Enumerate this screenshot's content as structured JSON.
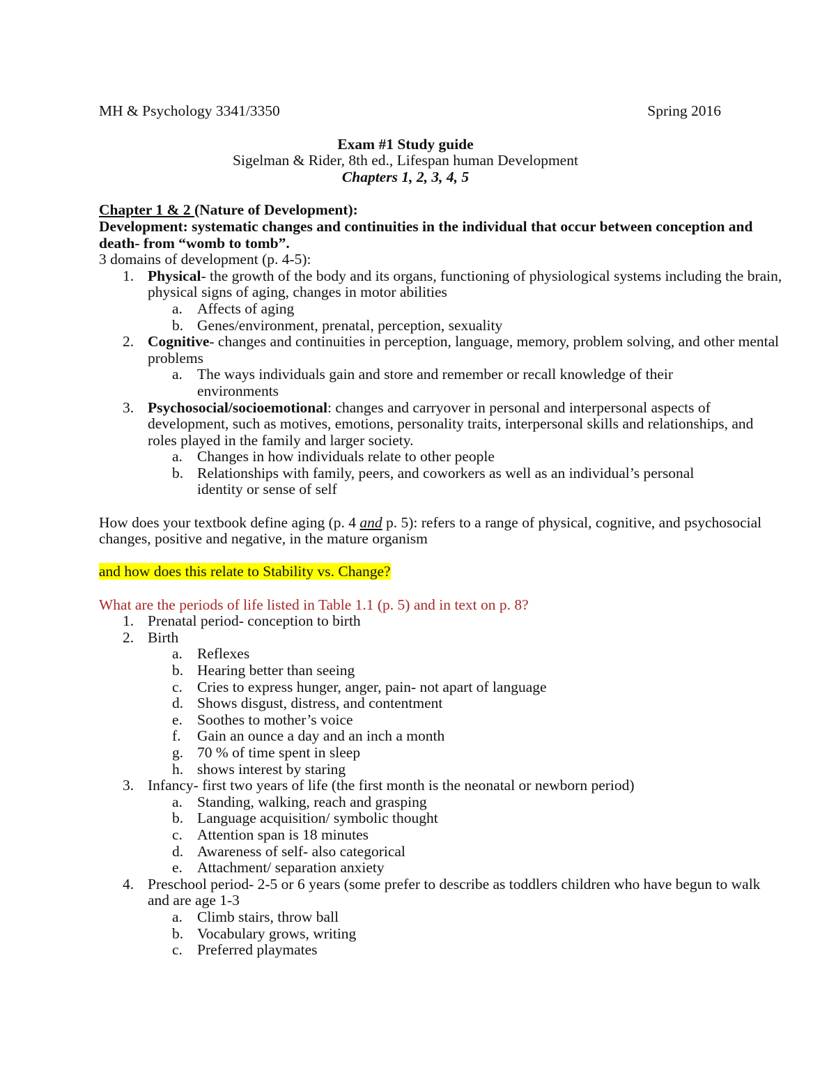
{
  "header": {
    "course": "MH & Psychology 3341/3350",
    "term": "Spring 2016",
    "title": "Exam #1 Study guide",
    "textbook": "Sigelman & Rider, 8th ed., Lifespan human Development",
    "chapters": "Chapters 1, 2, 3, 4, 5"
  },
  "section1": {
    "heading_underlined": "Chapter 1 & 2 ",
    "heading_rest": "(Nature of Development):",
    "definition": "Development: systematic changes and continuities in the individual that occur between conception and death- from “womb to tomb”.",
    "domains_intro": "3 domains of development (p. 4-5):",
    "domains": [
      {
        "num": "1.",
        "term": "Physical",
        "text": "- the growth of the body and its organs, functioning of physiological systems including the brain, physical signs of aging, changes in motor abilities",
        "sub": [
          {
            "letter": "a.",
            "text": "Affects of aging"
          },
          {
            "letter": "b.",
            "text": "Genes/environment, prenatal, perception, sexuality"
          }
        ]
      },
      {
        "num": "2.",
        "term": "Cognitive",
        "text": "- changes and continuities in perception, language, memory, problem solving, and other mental problems",
        "sub": [
          {
            "letter": "a.",
            "text": "The ways individuals gain and store and remember or recall knowledge of their environments"
          }
        ]
      },
      {
        "num": "3.",
        "term": "Psychosocial/socioemotional",
        "text": ": changes and carryover in personal and interpersonal aspects of development, such as motives, emotions, personality traits, interpersonal skills and relationships, and roles played in the family and larger society.",
        "sub": [
          {
            "letter": "a.",
            "text": "Changes in how individuals relate to other people"
          },
          {
            "letter": "b.",
            "text": "Relationships with family, peers, and coworkers as well as an individual’s personal identity or sense of self"
          }
        ]
      }
    ]
  },
  "aging": {
    "part1": "How does your textbook define aging (p. 4 ",
    "emphasis": "and",
    "part2": " p. 5): refers to a range of physical, cognitive, and psychosocial changes, positive and negative, in the mature organism"
  },
  "highlight_question": "and how does this relate to Stability vs. Change?",
  "periods": {
    "question": "What are the periods of life listed in Table 1.1 (p. 5) and in text on p. 8?",
    "items": [
      {
        "num": "1.",
        "text": "Prenatal period- conception to birth",
        "sub": []
      },
      {
        "num": "2.",
        "text": "Birth",
        "sub": [
          {
            "letter": "a.",
            "text": "Reflexes"
          },
          {
            "letter": "b.",
            "text": "Hearing better than seeing"
          },
          {
            "letter": "c.",
            "text": "Cries to express hunger, anger, pain- not apart of language"
          },
          {
            "letter": "d.",
            "text": "Shows disgust, distress, and contentment"
          },
          {
            "letter": "e.",
            "text": "Soothes to mother’s voice"
          },
          {
            "letter": "f.",
            "text": "Gain an ounce a day and an inch a month"
          },
          {
            "letter": "g.",
            "text": "70 % of time spent in sleep"
          },
          {
            "letter": "h.",
            "text": "shows interest by staring"
          }
        ]
      },
      {
        "num": "3.",
        "text": "Infancy- first two years of life (the first month is the neonatal or newborn period)",
        "sub": [
          {
            "letter": "a.",
            "text": "Standing, walking, reach and grasping"
          },
          {
            "letter": "b.",
            "text": "Language acquisition/ symbolic thought"
          },
          {
            "letter": "c.",
            "text": "Attention span is 18 minutes"
          },
          {
            "letter": "d.",
            "text": "Awareness of self- also categorical"
          },
          {
            "letter": "e.",
            "text": "Attachment/ separation anxiety"
          }
        ]
      },
      {
        "num": "4.",
        "text": "Preschool period- 2-5 or 6 years (some prefer to describe as toddlers children who have begun to walk and are age 1-3",
        "sub": [
          {
            "letter": "a.",
            "text": "Climb stairs, throw ball"
          },
          {
            "letter": "b.",
            "text": "Vocabulary grows, writing"
          },
          {
            "letter": "c.",
            "text": "Preferred playmates"
          }
        ]
      }
    ]
  },
  "colors": {
    "highlight": "#ffff00",
    "question_red": "#a52a2a",
    "text": "#111111"
  }
}
